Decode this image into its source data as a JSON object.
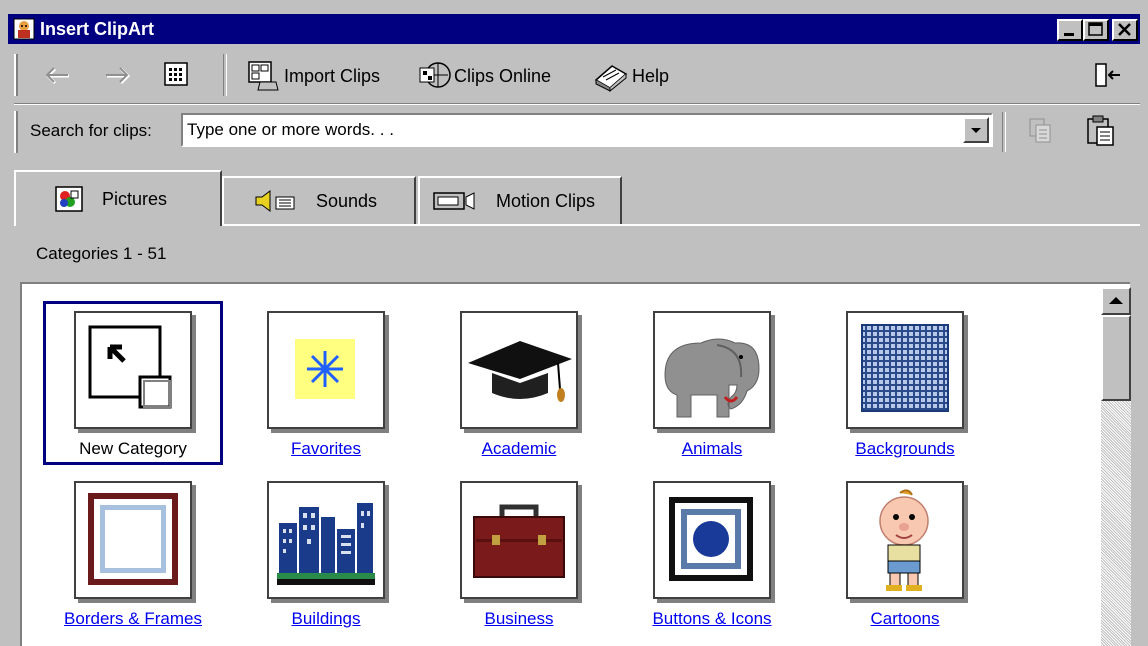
{
  "window": {
    "title": "Insert ClipArt"
  },
  "toolbar": {
    "import_clips": "Import Clips",
    "clips_online": "Clips Online",
    "help": "Help"
  },
  "search": {
    "label": "Search for clips:",
    "value": "Type one or more words. . ."
  },
  "tabs": [
    {
      "label": "Pictures",
      "active": true
    },
    {
      "label": "Sounds",
      "active": false
    },
    {
      "label": "Motion Clips",
      "active": false
    }
  ],
  "categories_label": "Categories 1 - 51",
  "categories": [
    {
      "label": "New Category",
      "icon": "new-category-icon",
      "selected": true
    },
    {
      "label": "Favorites",
      "icon": "favorites-icon"
    },
    {
      "label": "Academic",
      "icon": "graduation-cap-icon"
    },
    {
      "label": "Animals",
      "icon": "elephant-icon"
    },
    {
      "label": "Backgrounds",
      "icon": "grid-pattern-icon"
    },
    {
      "label": "Borders & Frames",
      "icon": "frame-icon"
    },
    {
      "label": "Buildings",
      "icon": "buildings-icon"
    },
    {
      "label": "Business",
      "icon": "briefcase-icon"
    },
    {
      "label": "Buttons & Icons",
      "icon": "button-icon"
    },
    {
      "label": "Cartoons",
      "icon": "cartoon-boy-icon"
    }
  ],
  "colors": {
    "titlebar": "#000080",
    "window": "#c0c0c0",
    "link": "#0000ee"
  }
}
